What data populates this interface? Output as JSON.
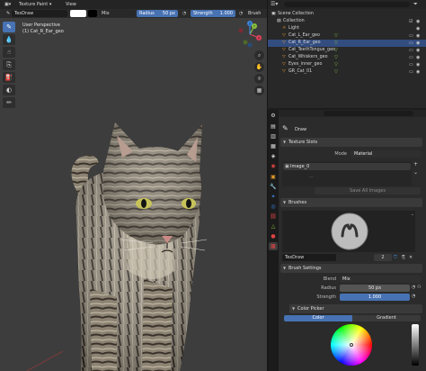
{
  "header": {
    "mode": "Texture Paint",
    "view": "View",
    "brush_name": "TexDraw",
    "blend_mode": "Mix",
    "radius_label": "Radius",
    "radius_value": "50 px",
    "strength_label": "Strength",
    "strength_value": "1.000",
    "brush_menu": "Brush"
  },
  "viewport": {
    "perspective": "User Perspective",
    "object_info": "(1) Cat_R_Ear_geo",
    "gizmo_axes": {
      "x": "X",
      "y": "Y",
      "z": "Z"
    }
  },
  "outliner": {
    "rows": [
      {
        "label": "Scene Collection",
        "indent": 0,
        "selected": false,
        "icons": ""
      },
      {
        "label": "Collection",
        "indent": 1,
        "selected": false,
        "icons": "☑ 👁"
      },
      {
        "label": "Light",
        "indent": 2,
        "selected": false,
        "icons": "👁"
      },
      {
        "label": "Cat_L_Ear_geo",
        "indent": 2,
        "selected": false,
        "icons": "👁 ▣"
      },
      {
        "label": "Cat_R_Ear_geo",
        "indent": 2,
        "selected": true,
        "icons": "👁 ▣"
      },
      {
        "label": "Cat_TeethTongue_geo",
        "indent": 2,
        "selected": false,
        "icons": "👁 ▣"
      },
      {
        "label": "Cat_Whiskers_geo",
        "indent": 2,
        "selected": false,
        "icons": "👁 ▣"
      },
      {
        "label": "Eyes_inner_geo",
        "indent": 2,
        "selected": false,
        "icons": "👁 ▣"
      },
      {
        "label": "GR_Cat_01",
        "indent": 2,
        "selected": false,
        "icons": "👁 ▣"
      }
    ]
  },
  "properties": {
    "active_tool": "Draw",
    "texture_slots": {
      "title": "Texture Slots",
      "mode_label": "Mode",
      "mode_value": "Material",
      "slot": "Image_0",
      "save_button": "Save All Images"
    },
    "brushes": {
      "title": "Brushes",
      "brush_name": "TexDraw",
      "users": "2"
    },
    "brush_settings": {
      "title": "Brush Settings",
      "blend_label": "Blend",
      "blend_value": "Mix",
      "radius_label": "Radius",
      "radius_value": "50 px",
      "strength_label": "Strength",
      "strength_value": "1.000"
    },
    "color_picker": {
      "title": "Color Picker",
      "tab_color": "Color",
      "tab_gradient": "Gradient"
    }
  },
  "colors": {
    "accent": "#4772b3",
    "selection": "#334d80",
    "viewport_bg": "#3d3d3d",
    "panel_bg": "#2b2b2b",
    "axis_x": "#e1415a",
    "axis_y": "#8bc53f",
    "axis_z": "#3d86e0"
  }
}
